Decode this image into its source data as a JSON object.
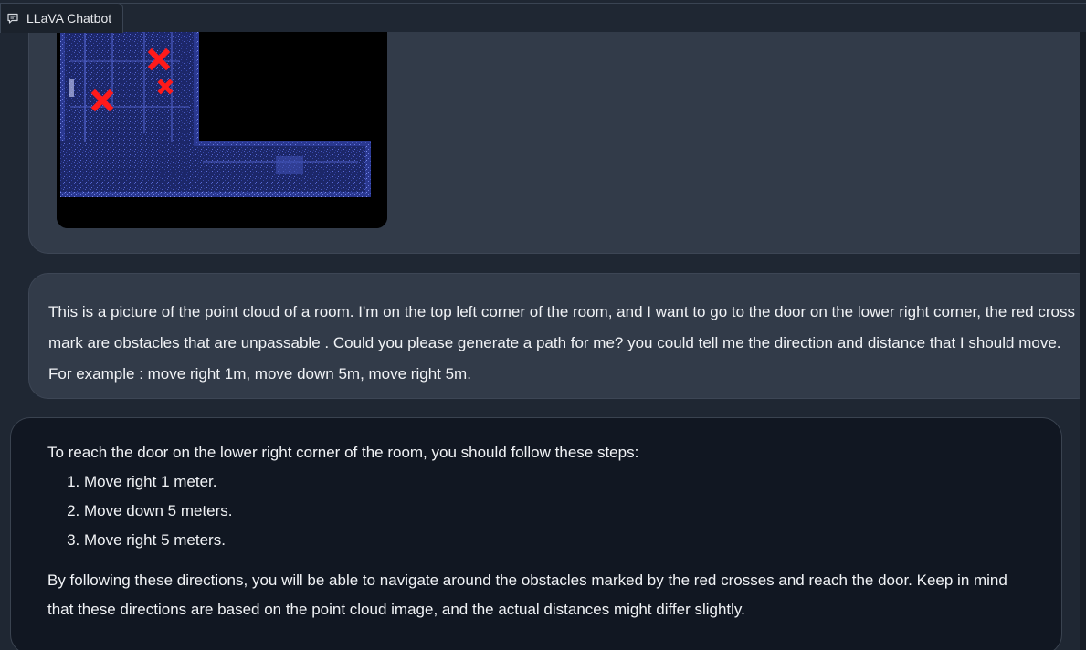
{
  "tab": {
    "label": "LLaVA Chatbot",
    "icon": "chat-icon"
  },
  "messages": {
    "user_image": {
      "alt": "point cloud of a room with red cross obstacle marks"
    },
    "user_text": "This is a picture of the point cloud of a room. I'm on the top left corner of the room, and I want to go to the door on the lower right corner, the red cross mark are obstacles that are unpassable . Could you please generate a path for me? you could tell me the direction and distance that I should move. For example : move right 1m, move down 5m, move right 5m.",
    "bot": {
      "intro": "To reach the door on the lower right corner of the room, you should follow these steps:",
      "steps": [
        "Move right 1 meter.",
        "Move down 5 meters.",
        "Move right 5 meters."
      ],
      "closing": "By following these directions, you will be able to navigate around the obstacles marked by the red crosses and reach the door. Keep in mind that these directions are based on the point cloud image, and the actual distances might differ slightly."
    }
  },
  "colors": {
    "background": "#1f2733",
    "user_bubble": "#323b49",
    "bot_bubble": "#111722",
    "cross_red": "#ff1a1a",
    "point_cloud_blue": "#3d4fb0"
  }
}
